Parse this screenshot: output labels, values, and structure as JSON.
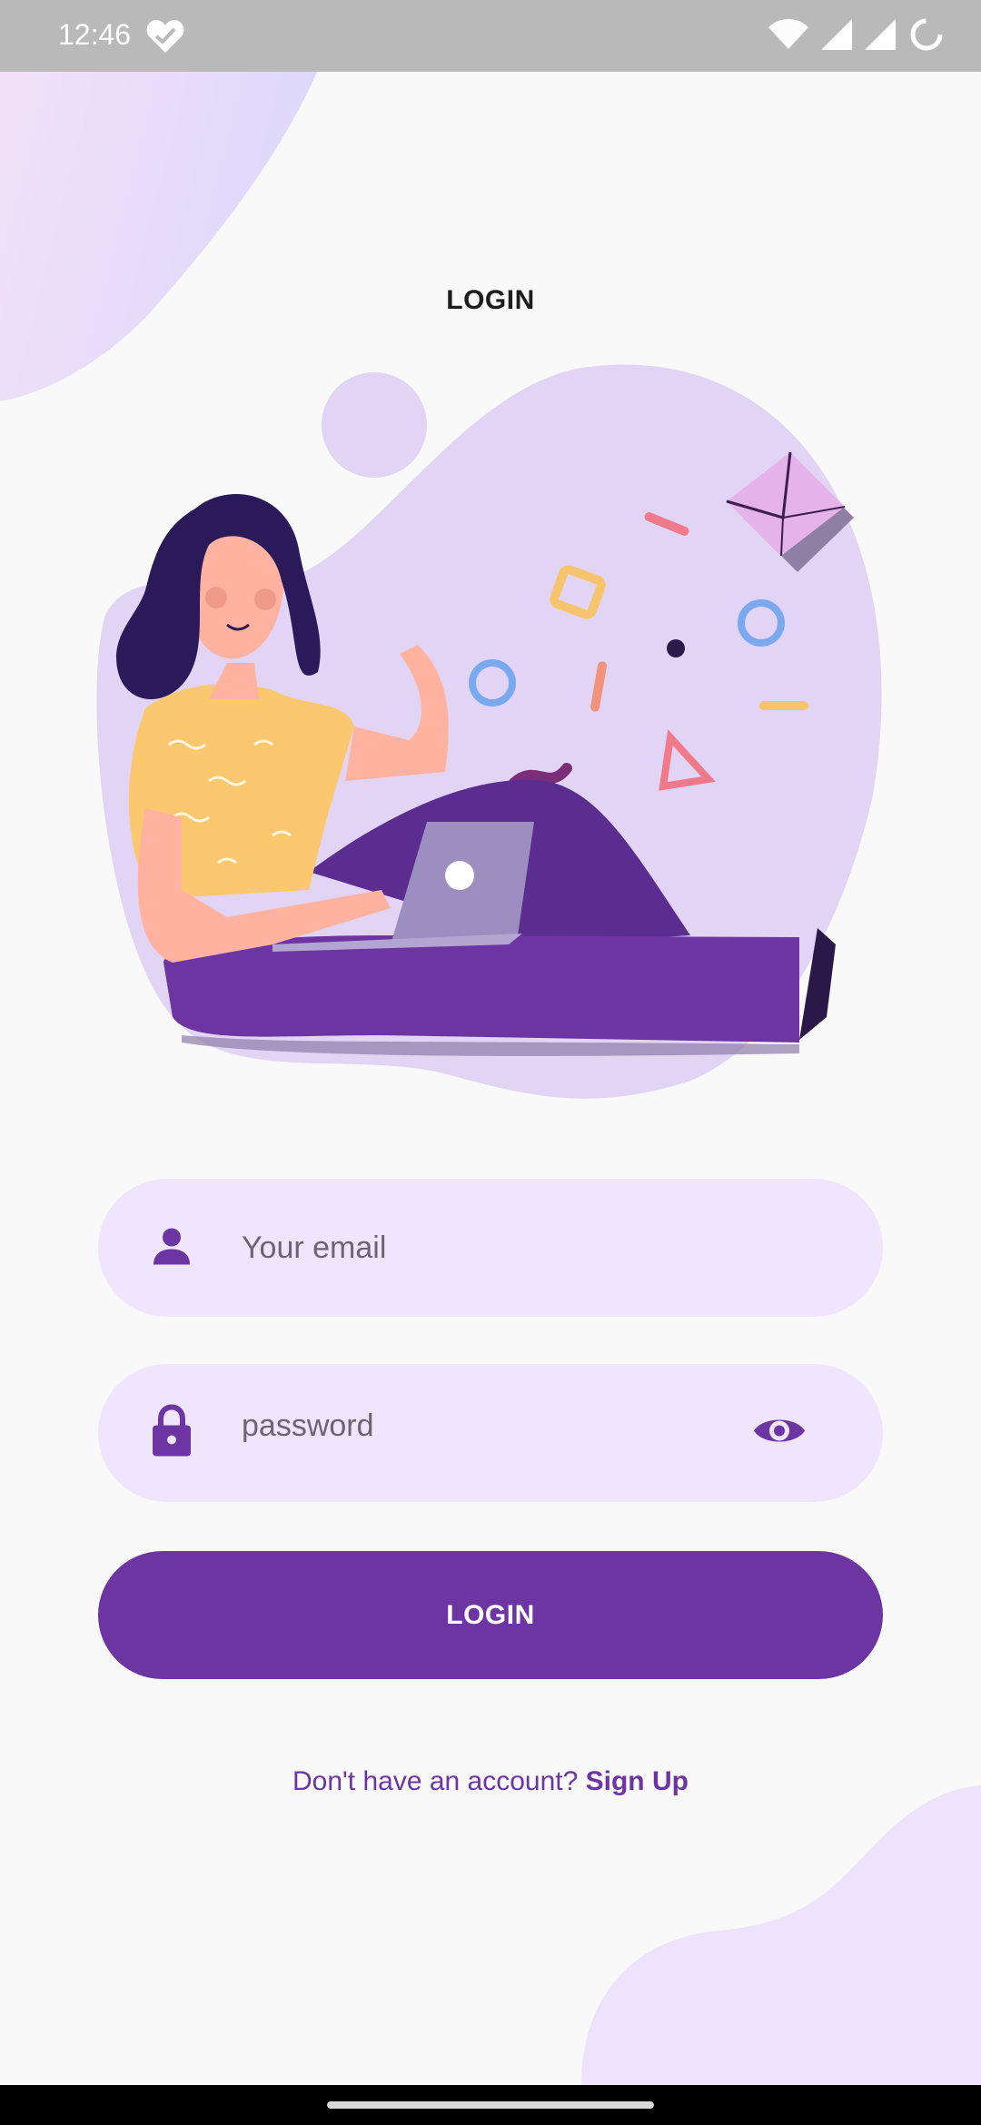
{
  "status_bar": {
    "time": "12:46",
    "icons": [
      "health-heart-icon",
      "wifi-icon",
      "signal-icon",
      "signal-icon",
      "battery-loading-icon"
    ]
  },
  "page": {
    "title": "LOGIN"
  },
  "illustration": {
    "subject": "woman-with-laptop-illustration"
  },
  "form": {
    "email": {
      "placeholder": "Your email",
      "value": "",
      "icon": "person-icon"
    },
    "password": {
      "placeholder": "password",
      "value": "",
      "icon": "lock-icon",
      "toggle_icon": "eye-icon"
    },
    "login_label": "LOGIN"
  },
  "signup": {
    "prompt": "Don't have an account? ",
    "link_label": "Sign Up"
  },
  "colors": {
    "primary": "#6D35A2",
    "field_background": "#EFE5FD",
    "page_background": "#F9F9F9",
    "blob": "#E8DDF8"
  }
}
